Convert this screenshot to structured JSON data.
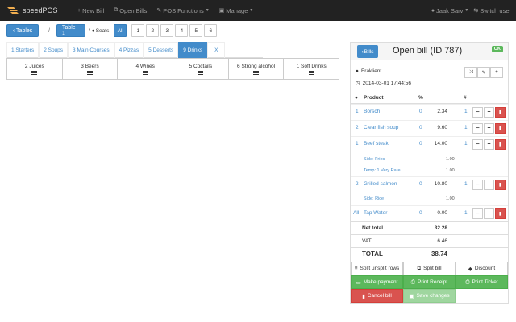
{
  "nav": {
    "brand": "speedPOS",
    "items": [
      {
        "icon": "plus-icon",
        "label": "New Bill"
      },
      {
        "icon": "copy-icon",
        "label": "Open Bills"
      },
      {
        "icon": "wrench-icon",
        "label": "POS Functions"
      },
      {
        "icon": "briefcase-icon",
        "label": "Manage"
      }
    ],
    "user": "Jaak Sarv",
    "switch_user": "Switch user"
  },
  "tablebar": {
    "tables_label": "Tables",
    "separator": "/",
    "table_label": "Table 1",
    "seats_label": "Seats",
    "seats": [
      "All",
      "1",
      "2",
      "3",
      "4",
      "5",
      "6"
    ],
    "active_seat": "All"
  },
  "categories": {
    "tabs": [
      "1 Starters",
      "2 Soups",
      "3 Main Courses",
      "4 Pizzas",
      "5 Desserts",
      "9 Drinks",
      "X"
    ],
    "active": "9 Drinks",
    "subcategories": [
      "2 Juices",
      "3 Beers",
      "4 Wines",
      "5 Coctails",
      "6 Strong alcohol",
      "1 Soft Drinks"
    ]
  },
  "bill": {
    "bills_button": "Bills",
    "title": "Open bill (ID 787)",
    "status": "OK",
    "customer": "Eraklient",
    "date": "2014-03-01 17:44:56",
    "columns": {
      "product": "Product",
      "percent": "%",
      "qty": "#"
    },
    "items": [
      {
        "seat": "1",
        "name": "Borsch",
        "pct": "0",
        "price": "2.34",
        "qty": "1"
      },
      {
        "seat": "2",
        "name": "Clear fish soup",
        "pct": "0",
        "price": "9.60",
        "qty": "1"
      },
      {
        "seat": "1",
        "name": "Beef steak",
        "pct": "0",
        "price": "14.00",
        "qty": "1"
      },
      {
        "seat": "2",
        "name": "Grilled salmon",
        "pct": "0",
        "price": "10.80",
        "qty": "1"
      },
      {
        "seat": "All",
        "name": "Tap Water",
        "pct": "0",
        "price": "0.00",
        "qty": "1"
      }
    ],
    "sub_lines": [
      {
        "label": "Side: Fries",
        "value": "1.00"
      },
      {
        "label": "Temp: 1 Very Rare",
        "value": "1.00"
      },
      {
        "label": "Side: Rice",
        "value": "1.00"
      }
    ],
    "totals": {
      "net_label": "Net total",
      "net": "32.28",
      "vat_label": "VAT",
      "vat": "6.46",
      "total_label": "TOTAL",
      "total": "38.74"
    },
    "actions": {
      "split_unsplit": "Split unsplit rows",
      "split_bill": "Split bill",
      "discount": "Discount",
      "make_payment": "Make payment",
      "print_receipt": "Print Receipt",
      "print_ticket": "Print Ticket",
      "cancel_bill": "Cancel bill",
      "save_changes": "Save changes"
    }
  },
  "colors": {
    "primary": "#428bca",
    "success": "#5cb85c",
    "danger": "#d9534f",
    "navbar": "#222222"
  }
}
